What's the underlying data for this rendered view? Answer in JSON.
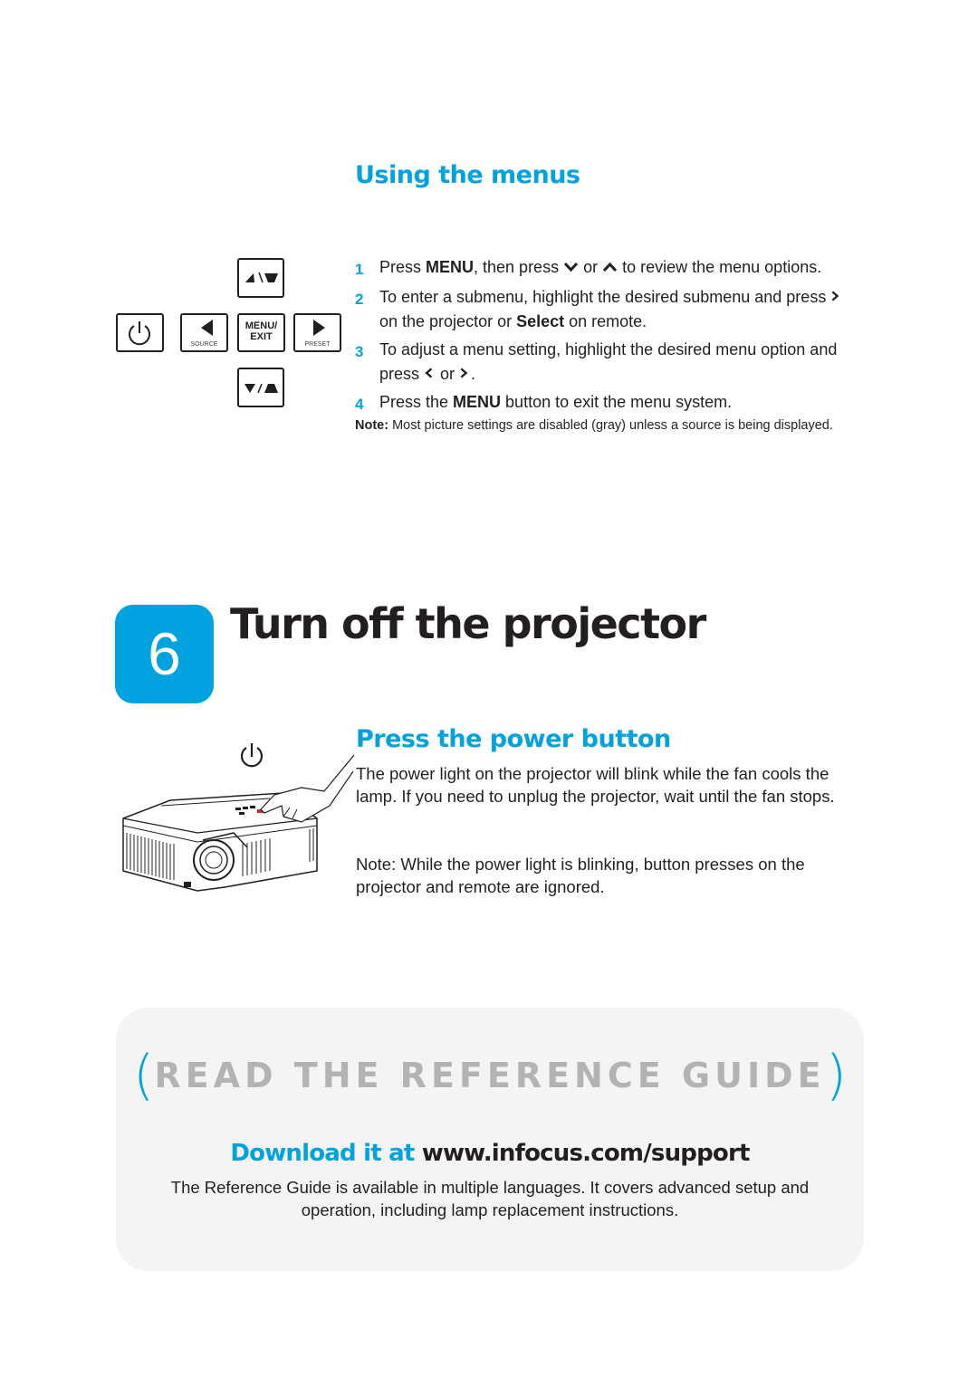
{
  "menus_section": {
    "heading": "Using the menus",
    "keypad": {
      "up_key_label": "▲\\▼ (keystone up)",
      "menu_key_label_line1": "MENU/",
      "menu_key_label_line2": "EXIT",
      "left_key_label": "SOURCE",
      "right_key_label": "PRESET"
    },
    "steps": [
      {
        "num": "1",
        "pre": "Press ",
        "bold1": "MENU",
        "mid1": ", then press ",
        "mid2": " or ",
        "post": " to review the menu options."
      },
      {
        "num": "2",
        "pre": "To enter a submenu, highlight the desired submenu and press ",
        "mid": " on the projector or ",
        "bold1": "Select",
        "post": " on remote."
      },
      {
        "num": "3",
        "pre": "To adjust a menu setting, highlight the desired menu option and press ",
        "mid": " or ",
        "post": "."
      },
      {
        "num": "4",
        "pre": "Press the ",
        "bold1": "MENU",
        "post": " button to exit the menu system."
      }
    ],
    "note_label": "Note:",
    "note_text": " Most picture settings are disabled (gray) unless a source is being displayed."
  },
  "section6": {
    "number": "6",
    "title": "Turn off the projector",
    "subheading": "Press the power button",
    "paragraph1": "The power light on the projector will blink while the fan cools the lamp. If you need to unplug the projector, wait until the fan stops.",
    "paragraph2": "Note: While the power light is blinking, button presses on the projector and remote are ignored."
  },
  "reference_box": {
    "open_paren": "(",
    "title": "READ THE REFERENCE GUIDE",
    "close_paren": ")",
    "download_prefix": "Download it at ",
    "download_url": "www.infocus.com/support",
    "description": "The Reference Guide is available in multiple languages. It covers advanced setup and operation, including lamp replacement instructions."
  },
  "colors": {
    "accent": "#00a3e0",
    "text": "#231f20",
    "box_bg": "#f4f4f4",
    "ref_title_gray": "#b3b3b3"
  }
}
